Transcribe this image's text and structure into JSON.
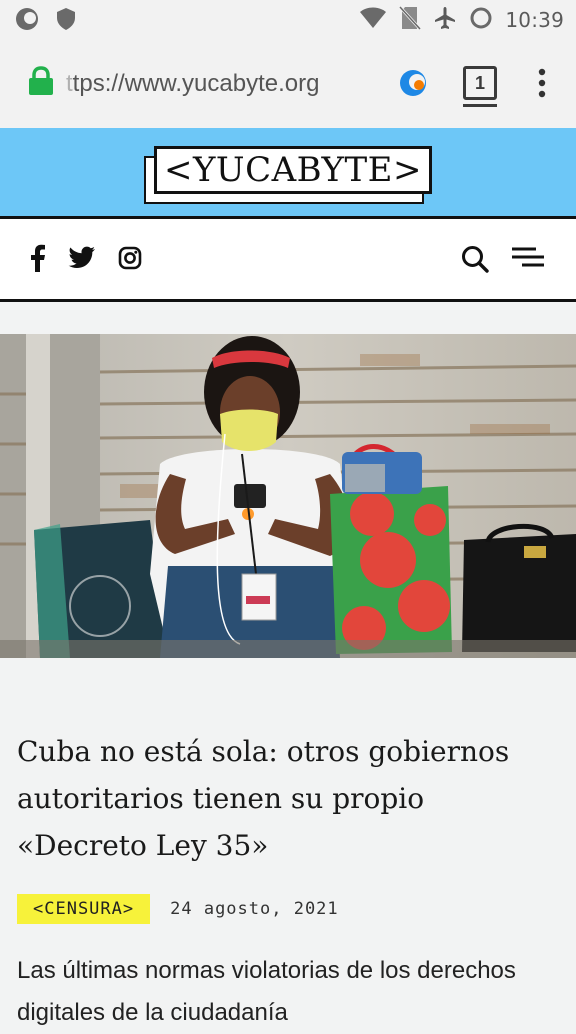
{
  "status_bar": {
    "time": "10:39",
    "icons": [
      "firefox-focus-icon",
      "shield-icon",
      "wifi-icon",
      "no-sim-icon",
      "airplane-mode-icon",
      "loading-ring-icon"
    ]
  },
  "browser": {
    "url_faded": "t",
    "url": "tps://www.yucabyte.org",
    "tab_count": "1",
    "icons": [
      "lock-icon",
      "browser-logo-icon",
      "tabs-icon",
      "overflow-menu-icon"
    ]
  },
  "site": {
    "logo_text": "<YUCABYTE>",
    "header_color": "#6dc7f7",
    "social_icons": [
      "facebook-icon",
      "twitter-icon",
      "instagram-icon"
    ],
    "nav_icons": [
      "search-icon",
      "hamburger-menu-icon"
    ]
  },
  "article": {
    "title": "Cuba no está sola: otros gobiernos autoritarios tienen su propio «Decreto Ley 35»",
    "category": "<CENSURA>",
    "category_color": "#f7f23a",
    "date": "24 agosto, 2021",
    "excerpt": "Las últimas normas violatorias de los derechos digitales de la ciudadanía"
  }
}
